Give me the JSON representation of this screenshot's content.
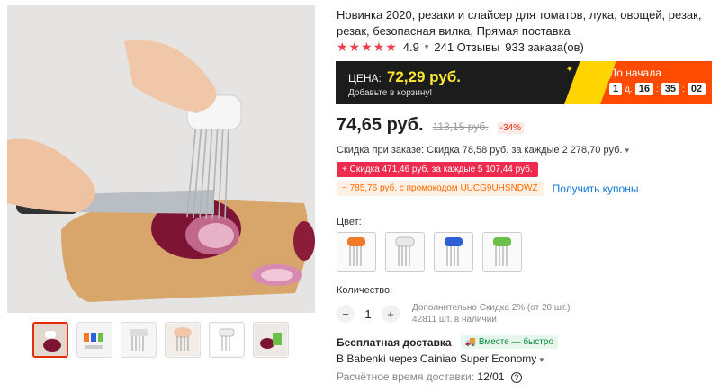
{
  "product": {
    "title": "Новинка 2020, резаки и слайсер для томатов, лука, овощей, резак, резак, безопасная вилка, Прямая поставка",
    "stars": "★★★★★",
    "rating": "4.9",
    "reviews": "241 Отзывы",
    "orders": "933 заказа(ов)"
  },
  "promo": {
    "label": "ЦЕНА:",
    "price": "72,29 руб.",
    "subtitle": "Добавьте в корзину!",
    "countdown_label": "До начала",
    "days": "1",
    "days_unit": "д.",
    "hours": "16",
    "minutes": "35",
    "seconds": "02"
  },
  "price": {
    "current": "74,65 руб.",
    "old": "113,15 руб.",
    "discount": "-34%"
  },
  "discounts": {
    "order_discount": "Скидка при заказе: Скидка 78,58 руб. за каждые 2 278,70 руб.",
    "red_tag": "+ Скидка 471,46 руб. за каждые 5 107,44 руб.",
    "coupon_tag": "− 785,76 руб. с промокодом UUCG9UHSNDWZ",
    "get_coupons": "Получить купоны"
  },
  "color": {
    "label": "Цвет:",
    "options": [
      {
        "name": "orange",
        "hex": "#f07a2a"
      },
      {
        "name": "white",
        "hex": "#d8d8d8"
      },
      {
        "name": "blue",
        "hex": "#2e5fd6"
      },
      {
        "name": "green",
        "hex": "#6cc04a"
      }
    ]
  },
  "quantity": {
    "label": "Количество:",
    "minus": "−",
    "value": "1",
    "plus": "+",
    "extra_discount": "Дополнительно Скидка 2% (от 20 шт.)",
    "stock": "42811 шт. в наличии"
  },
  "shipping": {
    "title": "Бесплатная доставка",
    "badge": "Вместе — быстро",
    "method": "В Babenki через Cainiao Super Economy",
    "time_label": "Расчётное время доставки:",
    "time_value": "12/01"
  },
  "colors": {
    "accent": "#e62e04",
    "promo_dark": "#1c1c1c",
    "promo_orange": "#ff4b00",
    "promo_yellow": "#ffe833",
    "link": "#1479d6"
  }
}
